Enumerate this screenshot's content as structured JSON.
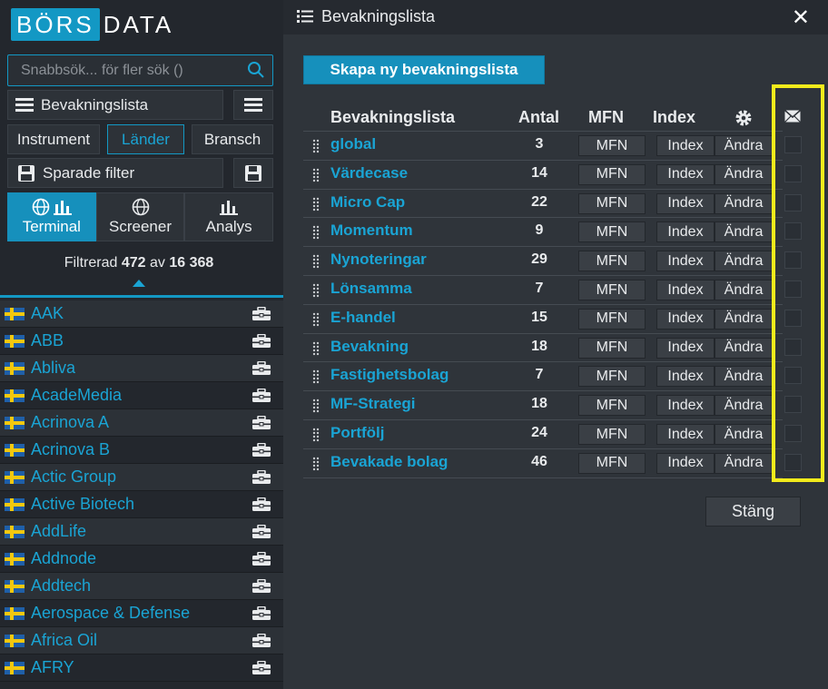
{
  "brand": {
    "logo_box": "BÖRS",
    "logo_rest": "DATA"
  },
  "sidebar": {
    "search_placeholder": "Snabbsök... för fler sök ()",
    "watchlist_label": "Bevakningslista",
    "filters": {
      "instrument": "Instrument",
      "lander": "Länder",
      "bransch": "Bransch"
    },
    "saved_filters_label": "Sparade filter",
    "tabs": {
      "terminal": "Terminal",
      "screener": "Screener",
      "analys": "Analys"
    },
    "filtered_prefix": "Filtrerad",
    "filtered_count": "472",
    "filtered_mid": "av",
    "filtered_total": "16 368",
    "companies": [
      "AAK",
      "ABB",
      "Abliva",
      "AcadeMedia",
      "Acrinova A",
      "Acrinova B",
      "Actic Group",
      "Active Biotech",
      "AddLife",
      "Addnode",
      "Addtech",
      "Aerospace & Defense",
      "Africa Oil",
      "AFRY"
    ]
  },
  "panel": {
    "title": "Bevakningslista",
    "create_button": "Skapa ny bevakningslista",
    "headers": {
      "name": "Bevakningslista",
      "count": "Antal",
      "mfn": "MFN",
      "index": "Index"
    },
    "row_buttons": {
      "mfn": "MFN",
      "index": "Index",
      "edit": "Ändra"
    },
    "lists": [
      {
        "name": "global",
        "count": "3"
      },
      {
        "name": "Värdecase",
        "count": "14"
      },
      {
        "name": "Micro Cap",
        "count": "22"
      },
      {
        "name": "Momentum",
        "count": "9"
      },
      {
        "name": "Nynoteringar",
        "count": "29"
      },
      {
        "name": "Lönsamma",
        "count": "7"
      },
      {
        "name": "E-handel",
        "count": "15"
      },
      {
        "name": "Bevakning",
        "count": "18"
      },
      {
        "name": "Fastighetsbolag",
        "count": "7"
      },
      {
        "name": "MF-Strategi",
        "count": "18"
      },
      {
        "name": "Portfölj",
        "count": "24"
      },
      {
        "name": "Bevakade bolag",
        "count": "46"
      }
    ],
    "close_button": "Stäng"
  },
  "colors": {
    "accent": "#1398c4",
    "highlight": "#f3eb1b",
    "link": "#1aa4d4"
  }
}
